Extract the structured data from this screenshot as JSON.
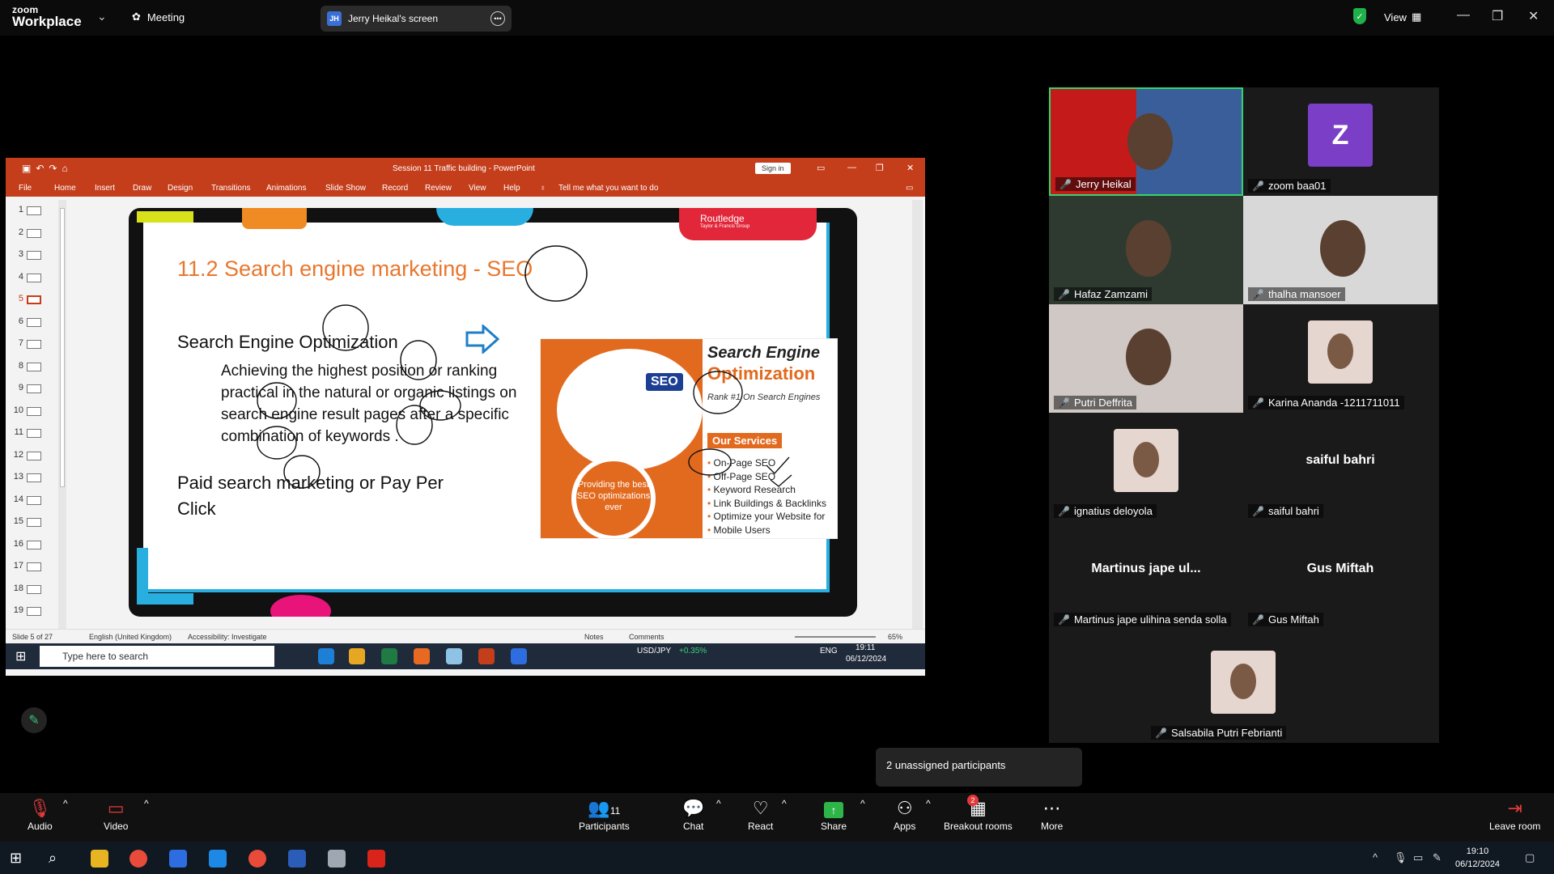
{
  "topbar": {
    "logo_top": "zoom",
    "logo_bottom": "Workplace",
    "meeting_label": "Meeting",
    "share_initials": "JH",
    "share_label": "Jerry Heikal's screen",
    "view_label": "View"
  },
  "powerpoint": {
    "window_title": "Session 11 Traffic building  -  PowerPoint",
    "sign_in": "Sign in",
    "ribbon_tabs": [
      "File",
      "Home",
      "Insert",
      "Draw",
      "Design",
      "Transitions",
      "Animations",
      "Slide Show",
      "Record",
      "Review",
      "View",
      "Help"
    ],
    "tell_me": "Tell me what you want to do",
    "slide_numbers": [
      "1",
      "2",
      "3",
      "4",
      "5",
      "6",
      "7",
      "8",
      "9",
      "10",
      "11",
      "12",
      "13",
      "14",
      "15",
      "16",
      "17",
      "18",
      "19"
    ],
    "active_slide": 5,
    "status_slide": "Slide 5 of 27",
    "status_lang": "English (United Kingdom)",
    "status_access": "Accessibility: Investigate",
    "status_notes": "Notes",
    "status_comments": "Comments",
    "status_zoom": "65%"
  },
  "slide": {
    "title": "11.2 Search engine marketing - SEO",
    "heading1": "Search Engine Optimization",
    "body": "Achieving the highest position or ranking practical in the natural or organic listings on search engine result pages after a specific combination of keywords .",
    "heading2": "Paid search marketing or Pay Per Click",
    "publisher": "Routledge",
    "publisher_sub": "Taylor & Francis Group",
    "card": {
      "badge": "SEO",
      "heading_a": "Search Engine",
      "heading_b": "Optimization",
      "rank_text": "Rank #1 On Search Engines",
      "ring_text": "Providing the best SEO optimizations ever",
      "services_label": "Our Services",
      "services": [
        "On-Page SEO",
        "Off-Page SEO",
        "Keyword Research",
        "Link Buildings & Backlinks",
        "Optimize your Website for",
        "Mobile Users"
      ]
    }
  },
  "inner_taskbar": {
    "search_placeholder": "Type here to search",
    "currency": "USD/JPY",
    "currency_change": "+0.35%",
    "lang": "ENG",
    "time": "19:11",
    "date": "06/12/2024"
  },
  "participants": [
    {
      "name": "Jerry Heikal",
      "kind": "video",
      "active": true
    },
    {
      "name": "zoom baa01",
      "kind": "avatar",
      "initial": "Z",
      "color": "#7b3fc7"
    },
    {
      "name": "Hafaz Zamzami",
      "kind": "video"
    },
    {
      "name": "thalha mansoer",
      "kind": "video"
    },
    {
      "name": "Putri Deffrita",
      "kind": "video"
    },
    {
      "name": "Karina Ananda -1211711011",
      "kind": "photo"
    },
    {
      "name": "ignatius deloyola",
      "kind": "photo"
    },
    {
      "name": "saiful bahri",
      "kind": "name",
      "display": "saiful bahri"
    },
    {
      "name": "Martinus jape ulihina senda solla",
      "kind": "name",
      "display": "Martinus jape ul..."
    },
    {
      "name": "Gus Miftah",
      "kind": "name",
      "display": "Gus Miftah"
    },
    {
      "name": "Salsabila Putri Febrianti",
      "kind": "photo"
    }
  ],
  "tooltip": "2 unassigned participants",
  "toolbar": {
    "audio": "Audio",
    "video": "Video",
    "participants": "Participants",
    "participants_count": "11",
    "chat": "Chat",
    "react": "React",
    "share": "Share",
    "apps": "Apps",
    "breakout": "Breakout rooms",
    "breakout_badge": "2",
    "more": "More",
    "leave": "Leave room"
  },
  "windows_taskbar": {
    "time": "19:10",
    "date": "06/12/2024"
  },
  "colors": {
    "powerpoint_red": "#c43e1c",
    "slide_orange": "#e8772e",
    "active_border": "#2fd56e",
    "share_green": "#2fb44a",
    "muted_red": "#e23a3a"
  }
}
